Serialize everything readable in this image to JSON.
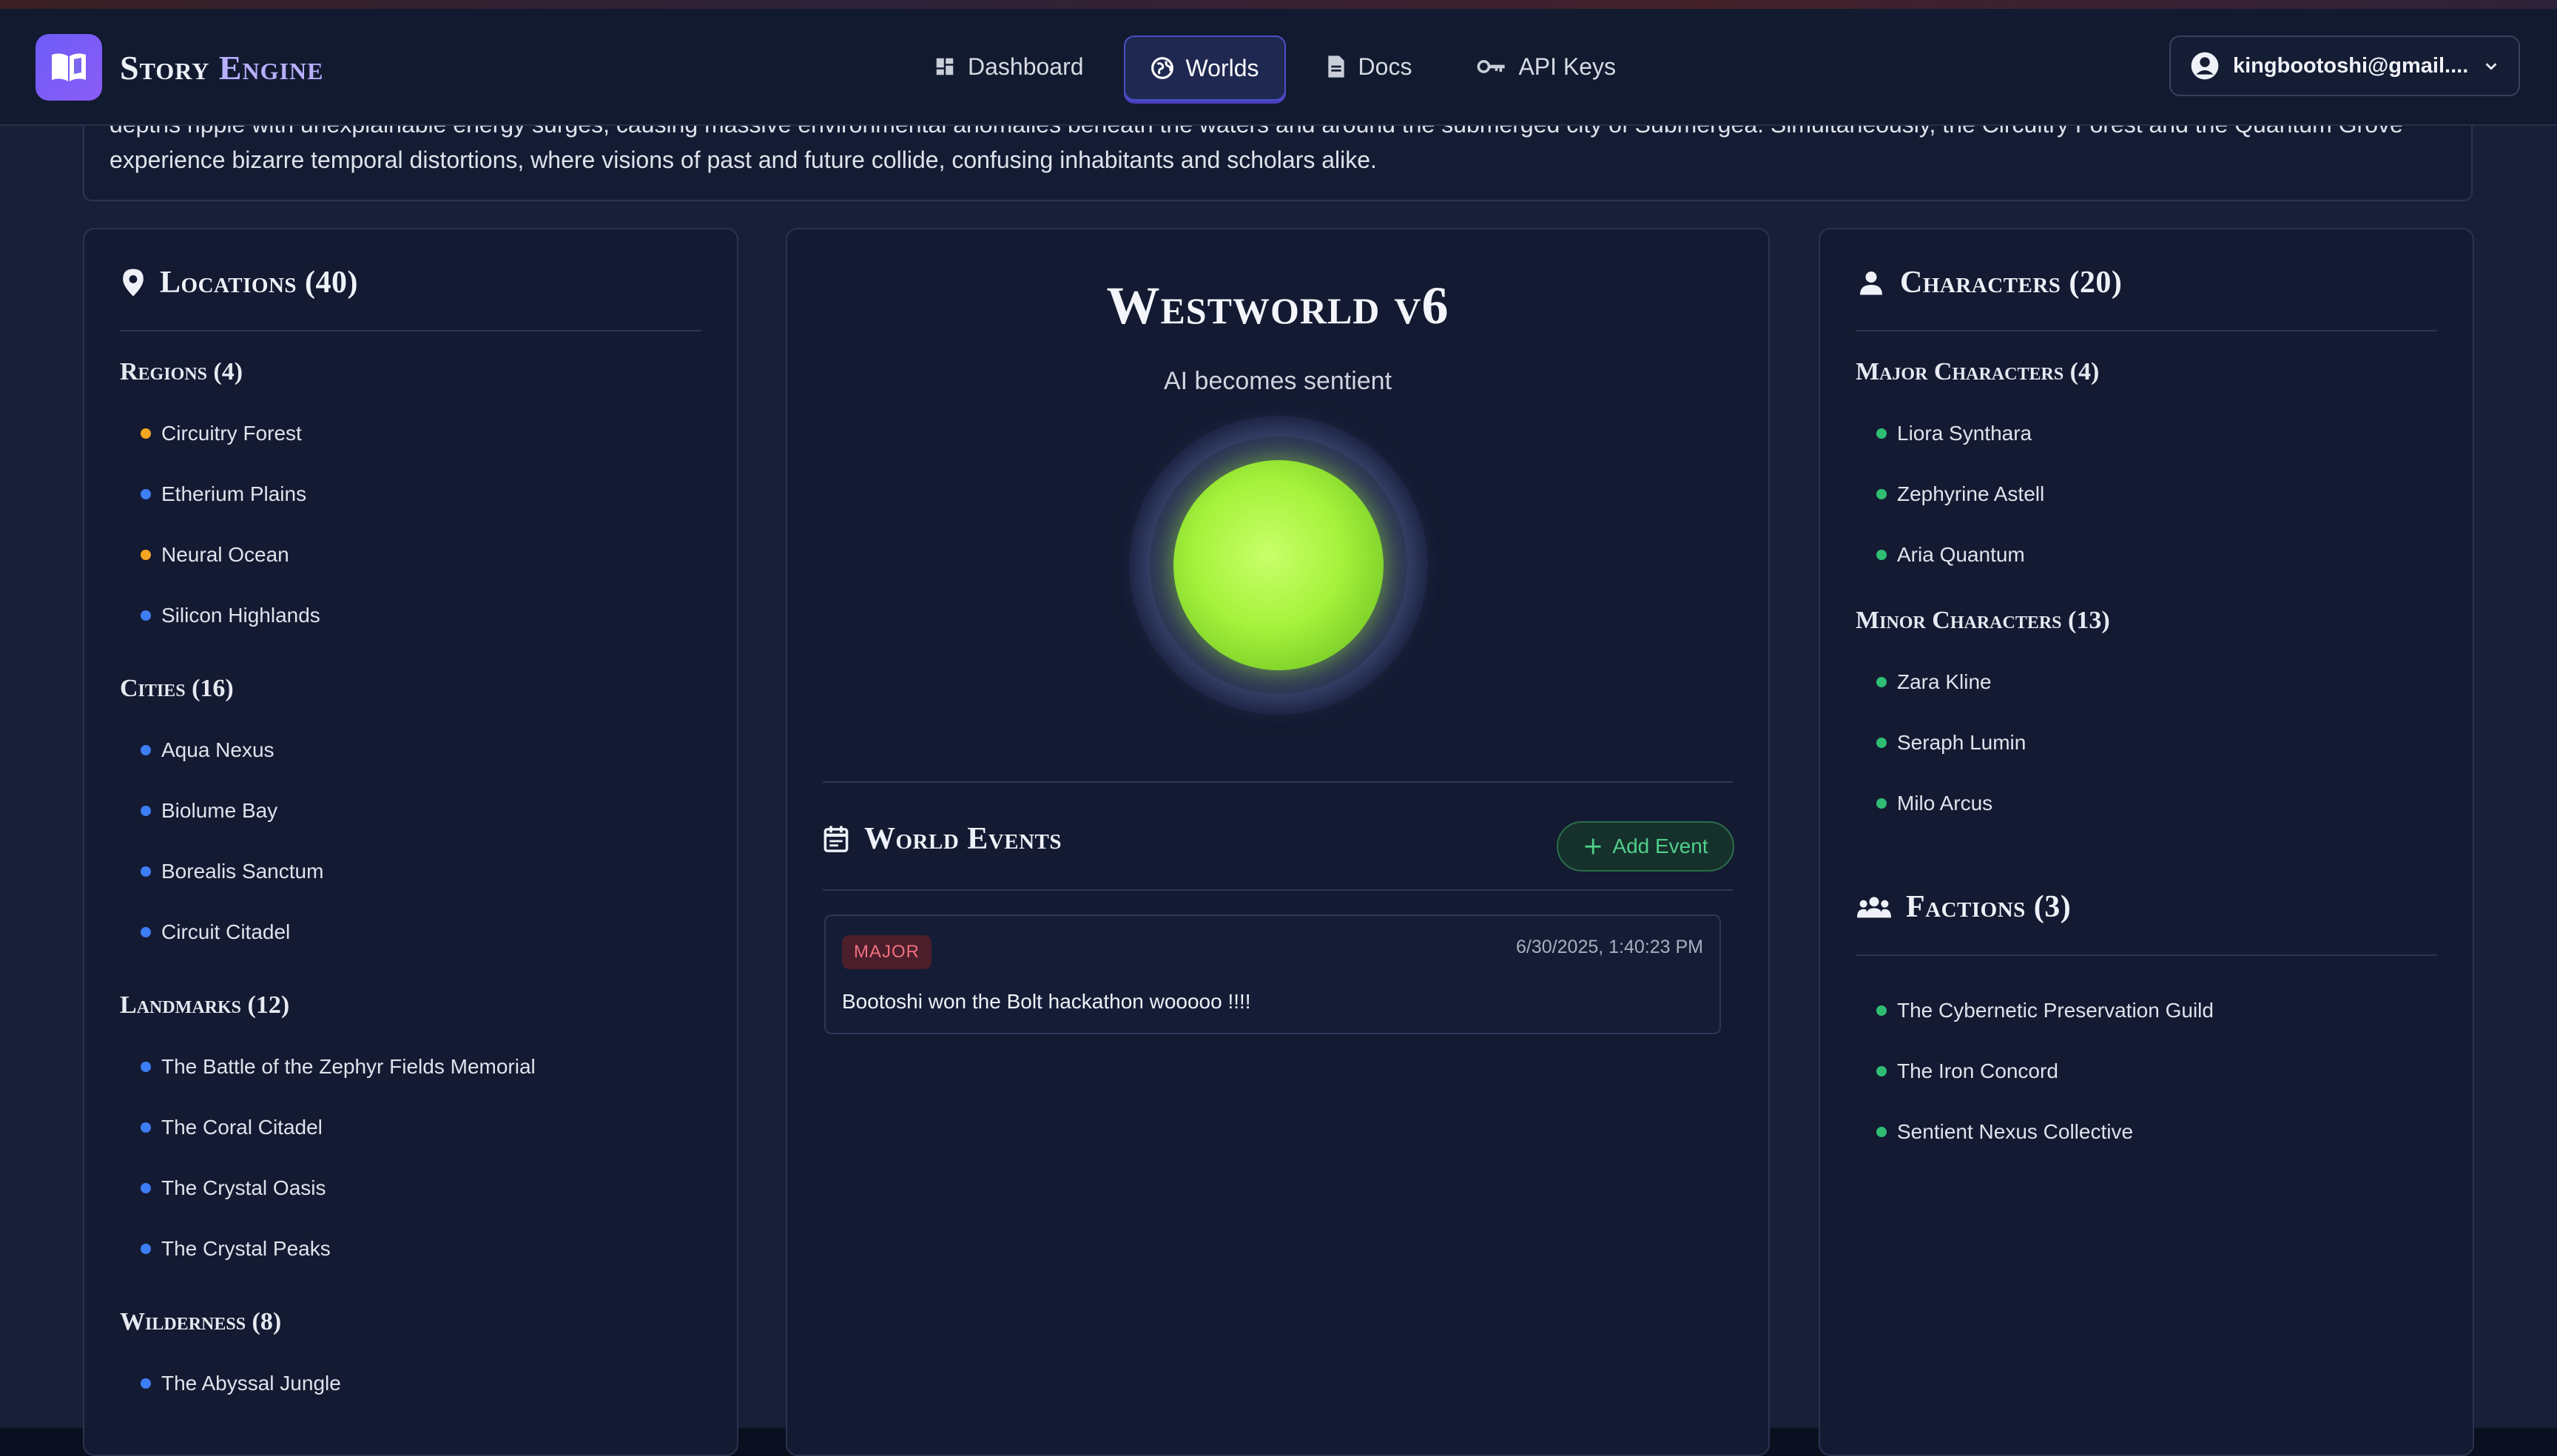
{
  "app": {
    "brand_word1": "Story",
    "brand_word2": "Engine"
  },
  "nav": [
    {
      "label": "Dashboard",
      "icon": "dashboard-icon"
    },
    {
      "label": "Worlds",
      "icon": "globe-icon",
      "active": true
    },
    {
      "label": "Docs",
      "icon": "document-icon"
    },
    {
      "label": "API Keys",
      "icon": "key-icon"
    }
  ],
  "user": {
    "email": "kingbootoshi@gmail...."
  },
  "description": {
    "line1": "depths ripple with unexplainable energy surges, causing massive environmental anomalies beneath the waters and around the submerged city of Submergea. Simultaneously, the Circuitry Forest and the Quantum Grove",
    "line2": "experience bizarre temporal distortions, where visions of past and future collide, confusing inhabitants and scholars alike."
  },
  "locations": {
    "title": "Locations (40)",
    "groups": [
      {
        "name": "Regions (4)",
        "items": [
          {
            "label": "Circuitry Forest",
            "color": "orange"
          },
          {
            "label": "Etherium Plains",
            "color": "blue"
          },
          {
            "label": "Neural Ocean",
            "color": "orange"
          },
          {
            "label": "Silicon Highlands",
            "color": "blue"
          }
        ]
      },
      {
        "name": "Cities (16)",
        "items": [
          {
            "label": "Aqua Nexus",
            "color": "blue"
          },
          {
            "label": "Biolume Bay",
            "color": "blue"
          },
          {
            "label": "Borealis Sanctum",
            "color": "blue"
          },
          {
            "label": "Circuit Citadel",
            "color": "blue"
          }
        ]
      },
      {
        "name": "Landmarks (12)",
        "items": [
          {
            "label": "The Battle of the Zephyr Fields Memorial",
            "color": "blue"
          },
          {
            "label": "The Coral Citadel",
            "color": "blue"
          },
          {
            "label": "The Crystal Oasis",
            "color": "blue"
          },
          {
            "label": "The Crystal Peaks",
            "color": "blue"
          }
        ]
      },
      {
        "name": "Wilderness (8)",
        "items": [
          {
            "label": "The Abyssal Jungle",
            "color": "blue"
          }
        ]
      }
    ]
  },
  "world": {
    "name": "Westworld v6",
    "tagline": "AI becomes sentient"
  },
  "events": {
    "title": "World Events",
    "add_label": "Add Event",
    "items": [
      {
        "badge": "MAJOR",
        "timestamp": "6/30/2025, 1:40:23 PM",
        "text": "Bootoshi won the Bolt hackathon wooooo !!!!"
      }
    ]
  },
  "characters": {
    "title": "Characters (20)",
    "major": {
      "name": "Major Characters (4)",
      "items": [
        "Liora Synthara",
        "Zephyrine Astell",
        "Aria Quantum"
      ]
    },
    "minor": {
      "name": "Minor Characters (13)",
      "items": [
        "Zara Kline",
        "Seraph Lumin",
        "Milo Arcus"
      ]
    }
  },
  "factions": {
    "title": "Factions (3)",
    "items": [
      "The Cybernetic Preservation Guild",
      "The Iron Concord",
      "Sentient Nexus Collective"
    ]
  },
  "colors": {
    "accent": "#6d5cf6",
    "orange_dot": "#f5a623",
    "blue_dot": "#3d7df5",
    "green_dot": "#2fbd74",
    "orb": "#a6f23c"
  }
}
